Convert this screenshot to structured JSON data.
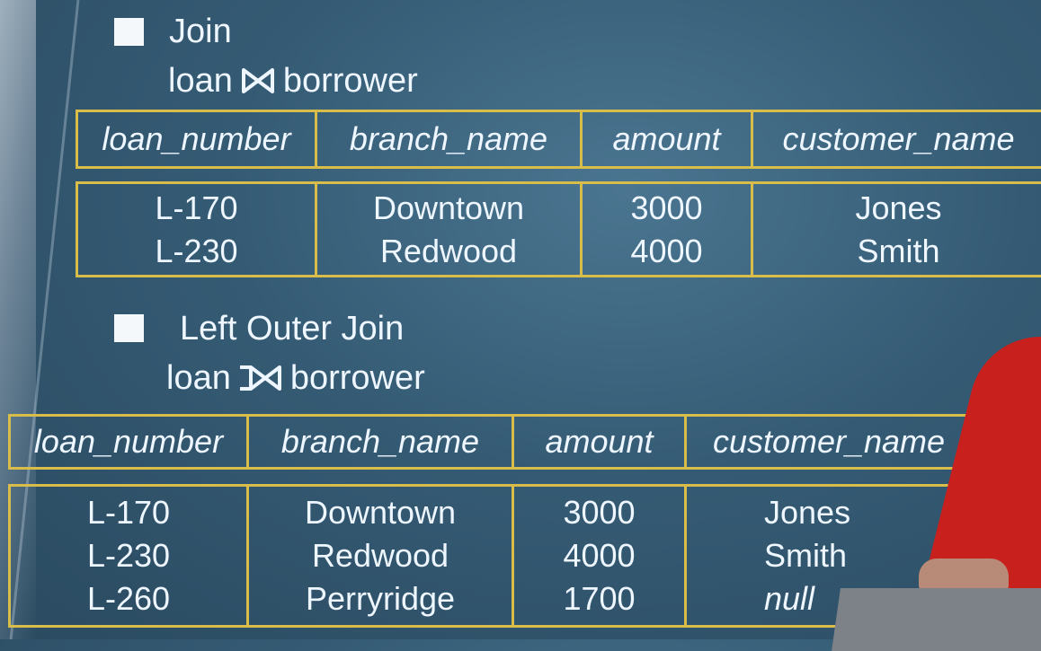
{
  "sections": [
    {
      "title": "Join",
      "expression": {
        "left": "loan",
        "operator": "⋈",
        "right": "borrower"
      },
      "columns": [
        "loan_number",
        "branch_name",
        "amount",
        "customer_name"
      ],
      "rows": [
        [
          "L-170",
          "Downtown",
          "3000",
          "Jones"
        ],
        [
          "L-230",
          "Redwood",
          "4000",
          "Smith"
        ]
      ]
    },
    {
      "title": "Left Outer Join",
      "expression": {
        "left": "loan",
        "operator": "⟕",
        "right": "borrower"
      },
      "columns": [
        "loan_number",
        "branch_name",
        "amount",
        "customer_name"
      ],
      "rows": [
        [
          "L-170",
          "Downtown",
          "3000",
          "Jones"
        ],
        [
          "L-230",
          "Redwood",
          "4000",
          "Smith"
        ],
        [
          "L-260",
          "Perryridge",
          "1700",
          "null"
        ]
      ]
    }
  ],
  "colors": {
    "background": "#355b74",
    "table_border": "#d8bd4a",
    "text": "#eef6ff"
  }
}
